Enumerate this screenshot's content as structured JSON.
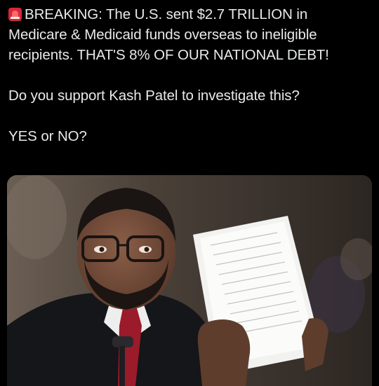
{
  "post": {
    "lines": [
      "BREAKING: The U.S. sent $2.7 TRILLION in",
      "Medicare & Medicaid funds overseas to ineligible",
      "recipients. THAT'S 8% OF OUR NATIONAL DEBT!",
      "Do you support Kash Patel to investigate this?",
      "YES or NO?"
    ],
    "icon": "siren-emoji-icon"
  },
  "media": {
    "icon": "hearing-photo-man-holding-papers"
  },
  "colors": {
    "background": "#000000",
    "text": "#e7e9ea",
    "siren": "#d6283a",
    "tie": "#9b1b2a"
  }
}
